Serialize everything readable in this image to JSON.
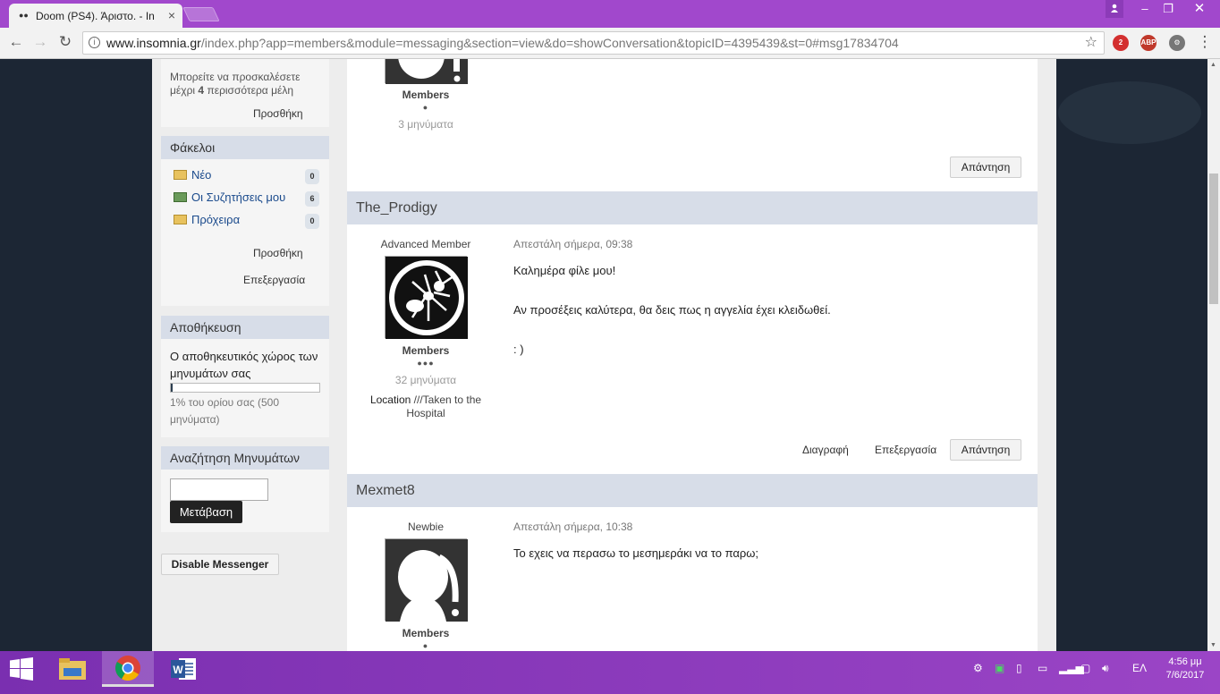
{
  "browser": {
    "tab_title": "Doom (PS4). Άριστο. - In",
    "url_host": "www.insomnia.gr",
    "url_path": "/index.php?app=members&module=messaging&section=view&do=showConversation&topicID=4395439&st=0#msg17834704",
    "ext_badge": "2",
    "abp_label": "ABP"
  },
  "sidebar": {
    "invite_text": "Μπορείτε να προσκαλέσετε μέχρι",
    "invite_count": "4",
    "invite_tail": "περισσότερα μέλη",
    "invite_add": "Προσθήκη",
    "folders_title": "Φάκελοι",
    "folders": [
      {
        "label": "Νέο",
        "count": "0"
      },
      {
        "label": "Οι Συζητήσεις μου",
        "count": "6"
      },
      {
        "label": "Πρόχειρα",
        "count": "0"
      }
    ],
    "folders_add": "Προσθήκη",
    "folders_edit": "Επεξεργασία",
    "storage_title": "Αποθήκευση",
    "storage_text": "Ο αποθηκευτικός χώρος των μηνυμάτων σας",
    "storage_percent": 1,
    "storage_limit": "1% του ορίου σας (500 μηνύματα)",
    "search_title": "Αναζήτηση Μηνυμάτων",
    "search_value": "",
    "search_button": "Μετάβαση",
    "disable_button": "Disable Messenger"
  },
  "posts": {
    "p0": {
      "group": "Members",
      "pips": "●",
      "count": "3 μηνύματα",
      "reply": "Απάντηση"
    },
    "p1": {
      "author": "The_Prodigy",
      "rank": "Advanced Member",
      "group": "Members",
      "pips": "●●●",
      "count": "32 μηνύματα",
      "location_label": "Location",
      "location_value": "///Taken to the Hospital",
      "sent": "Απεστάλη σήμερα, 09:38",
      "line1": "Καλημέρα φίλε μου!",
      "line2": "Αν προσέξεις καλύτερα, θα δεις πως η αγγελία έχει κλειδωθεί.",
      "line3": ": )",
      "delete": "Διαγραφή",
      "edit": "Επεξεργασία",
      "reply": "Απάντηση"
    },
    "p2": {
      "author": "Mexmet8",
      "rank": "Newbie",
      "group": "Members",
      "pips": "●",
      "sent": "Απεστάλη σήμερα, 10:38",
      "line1": "Το εχεις να περασω το μεσημεράκι να το παρω;"
    }
  },
  "taskbar": {
    "lang": "ΕΛ",
    "time": "4:56 μμ",
    "date": "7/6/2017"
  }
}
